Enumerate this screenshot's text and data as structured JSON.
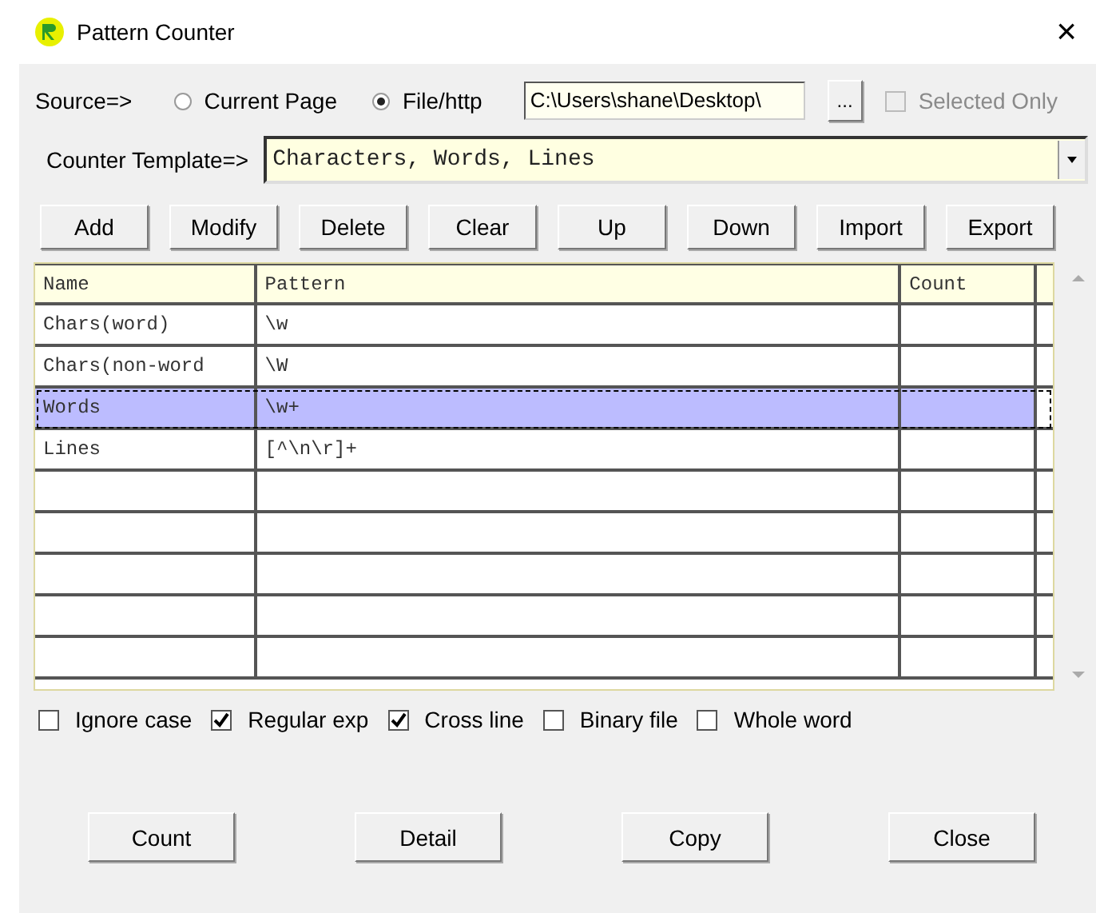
{
  "window": {
    "title": "Pattern Counter",
    "close": "×"
  },
  "source": {
    "label": "Source=>",
    "options": [
      {
        "label": "Current Page",
        "selected": false
      },
      {
        "label": "File/http",
        "selected": true
      }
    ],
    "path": "C:\\Users\\shane\\Desktop\\",
    "browse": "...",
    "selected_only": {
      "label": "Selected Only",
      "checked": false,
      "disabled": true
    }
  },
  "template": {
    "label": "Counter Template=>",
    "value": "Characters, Words, Lines"
  },
  "toolbar": [
    "Add",
    "Modify",
    "Delete",
    "Clear",
    "Up",
    "Down",
    "Import",
    "Export"
  ],
  "table": {
    "columns": [
      "Name",
      "Pattern",
      "Count"
    ],
    "rows": [
      {
        "name": "Chars(word)",
        "pattern": "\\w",
        "selected": false
      },
      {
        "name": "Chars(non-word",
        "pattern": "\\W",
        "selected": false
      },
      {
        "name": "Words",
        "pattern": "\\w+",
        "selected": true
      },
      {
        "name": "Lines",
        "pattern": "[^\\n\\r]+",
        "selected": false
      }
    ]
  },
  "options": [
    {
      "label": "Ignore case",
      "checked": false
    },
    {
      "label": "Regular exp",
      "checked": true
    },
    {
      "label": "Cross line",
      "checked": true
    },
    {
      "label": "Binary file",
      "checked": false
    },
    {
      "label": "Whole word",
      "checked": false
    }
  ],
  "buttons": [
    "Count",
    "Detail",
    "Copy",
    "Close"
  ]
}
